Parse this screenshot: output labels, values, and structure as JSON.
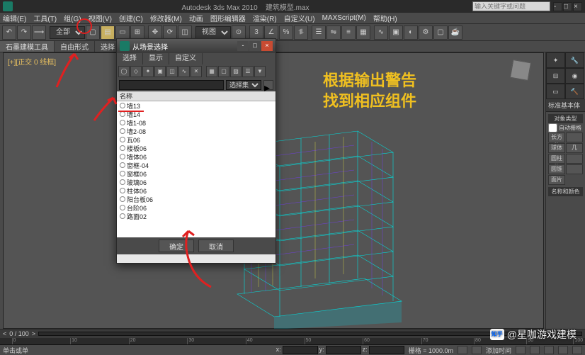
{
  "titlebar": {
    "app": "Autodesk 3ds Max 2010",
    "file": "建筑模型.max",
    "search_placeholder": "输入关键字或问题"
  },
  "menubar": [
    "编辑(E)",
    "工具(T)",
    "组(G)",
    "视图(V)",
    "创建(C)",
    "修改器(M)",
    "动画",
    "图形编辑器",
    "渲染(R)",
    "自定义(U)",
    "MAXScript(M)",
    "帮助(H)"
  ],
  "toolbar": {
    "select_filter": "全部",
    "view_sel": "视图"
  },
  "tabs": [
    "石墨建模工具",
    "自由形式",
    "选择"
  ],
  "viewport_label": "[+][正交 0 线框]",
  "dialog": {
    "title": "从场景选择",
    "tabs": [
      "选择",
      "显示",
      "自定义"
    ],
    "filter_sel": "选择集",
    "header": "名称",
    "items": [
      "墙13",
      "墙14",
      "墙1-08",
      "墙2-08",
      "瓦06",
      "楼板06",
      "墙体06",
      "窗框-04",
      "窗框06",
      "玻璃06",
      "柱体06",
      "阳台板06",
      "台阶06",
      "路面02"
    ],
    "ok": "确定",
    "cancel": "取消"
  },
  "right": {
    "head": "标准基本体",
    "section": "对象类型",
    "auto": "自动栅格",
    "btns": [
      "长方体",
      "",
      "球体",
      "几",
      "圆柱体",
      "",
      "圆锥",
      "",
      "面片"
    ],
    "name_sec": "名称和颜色"
  },
  "bottom": {
    "frame": "0 / 100",
    "prompt": "单击或单",
    "x": "x:",
    "y": "y:",
    "z": "z:",
    "grid": "栅格 = 1000.0m",
    "addtime": "添加时间"
  },
  "annotation": {
    "line1": "根据输出警告",
    "line2": "找到相应组件"
  },
  "watermark": "@星咖游戏建模",
  "zhihu": "知乎"
}
